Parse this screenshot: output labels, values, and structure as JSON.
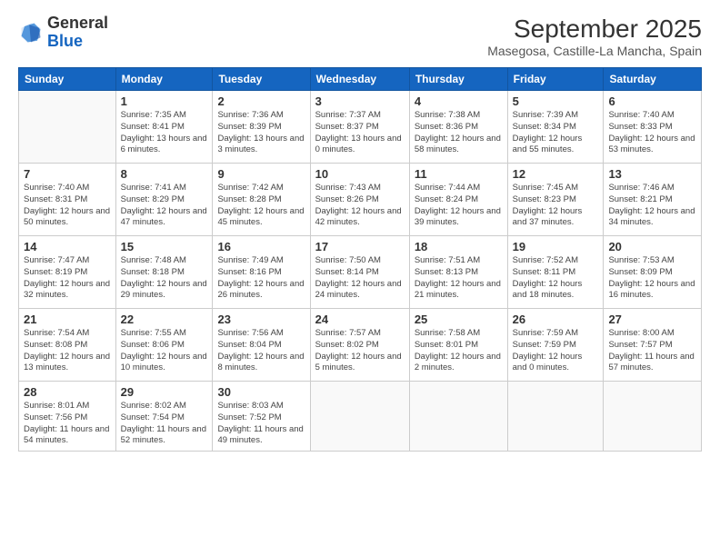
{
  "logo": {
    "general": "General",
    "blue": "Blue"
  },
  "header": {
    "month": "September 2025",
    "location": "Masegosa, Castille-La Mancha, Spain"
  },
  "weekdays": [
    "Sunday",
    "Monday",
    "Tuesday",
    "Wednesday",
    "Thursday",
    "Friday",
    "Saturday"
  ],
  "weeks": [
    [
      {
        "day": "",
        "sunrise": "",
        "sunset": "",
        "daylight": ""
      },
      {
        "day": "1",
        "sunrise": "Sunrise: 7:35 AM",
        "sunset": "Sunset: 8:41 PM",
        "daylight": "Daylight: 13 hours and 6 minutes."
      },
      {
        "day": "2",
        "sunrise": "Sunrise: 7:36 AM",
        "sunset": "Sunset: 8:39 PM",
        "daylight": "Daylight: 13 hours and 3 minutes."
      },
      {
        "day": "3",
        "sunrise": "Sunrise: 7:37 AM",
        "sunset": "Sunset: 8:37 PM",
        "daylight": "Daylight: 13 hours and 0 minutes."
      },
      {
        "day": "4",
        "sunrise": "Sunrise: 7:38 AM",
        "sunset": "Sunset: 8:36 PM",
        "daylight": "Daylight: 12 hours and 58 minutes."
      },
      {
        "day": "5",
        "sunrise": "Sunrise: 7:39 AM",
        "sunset": "Sunset: 8:34 PM",
        "daylight": "Daylight: 12 hours and 55 minutes."
      },
      {
        "day": "6",
        "sunrise": "Sunrise: 7:40 AM",
        "sunset": "Sunset: 8:33 PM",
        "daylight": "Daylight: 12 hours and 53 minutes."
      }
    ],
    [
      {
        "day": "7",
        "sunrise": "Sunrise: 7:40 AM",
        "sunset": "Sunset: 8:31 PM",
        "daylight": "Daylight: 12 hours and 50 minutes."
      },
      {
        "day": "8",
        "sunrise": "Sunrise: 7:41 AM",
        "sunset": "Sunset: 8:29 PM",
        "daylight": "Daylight: 12 hours and 47 minutes."
      },
      {
        "day": "9",
        "sunrise": "Sunrise: 7:42 AM",
        "sunset": "Sunset: 8:28 PM",
        "daylight": "Daylight: 12 hours and 45 minutes."
      },
      {
        "day": "10",
        "sunrise": "Sunrise: 7:43 AM",
        "sunset": "Sunset: 8:26 PM",
        "daylight": "Daylight: 12 hours and 42 minutes."
      },
      {
        "day": "11",
        "sunrise": "Sunrise: 7:44 AM",
        "sunset": "Sunset: 8:24 PM",
        "daylight": "Daylight: 12 hours and 39 minutes."
      },
      {
        "day": "12",
        "sunrise": "Sunrise: 7:45 AM",
        "sunset": "Sunset: 8:23 PM",
        "daylight": "Daylight: 12 hours and 37 minutes."
      },
      {
        "day": "13",
        "sunrise": "Sunrise: 7:46 AM",
        "sunset": "Sunset: 8:21 PM",
        "daylight": "Daylight: 12 hours and 34 minutes."
      }
    ],
    [
      {
        "day": "14",
        "sunrise": "Sunrise: 7:47 AM",
        "sunset": "Sunset: 8:19 PM",
        "daylight": "Daylight: 12 hours and 32 minutes."
      },
      {
        "day": "15",
        "sunrise": "Sunrise: 7:48 AM",
        "sunset": "Sunset: 8:18 PM",
        "daylight": "Daylight: 12 hours and 29 minutes."
      },
      {
        "day": "16",
        "sunrise": "Sunrise: 7:49 AM",
        "sunset": "Sunset: 8:16 PM",
        "daylight": "Daylight: 12 hours and 26 minutes."
      },
      {
        "day": "17",
        "sunrise": "Sunrise: 7:50 AM",
        "sunset": "Sunset: 8:14 PM",
        "daylight": "Daylight: 12 hours and 24 minutes."
      },
      {
        "day": "18",
        "sunrise": "Sunrise: 7:51 AM",
        "sunset": "Sunset: 8:13 PM",
        "daylight": "Daylight: 12 hours and 21 minutes."
      },
      {
        "day": "19",
        "sunrise": "Sunrise: 7:52 AM",
        "sunset": "Sunset: 8:11 PM",
        "daylight": "Daylight: 12 hours and 18 minutes."
      },
      {
        "day": "20",
        "sunrise": "Sunrise: 7:53 AM",
        "sunset": "Sunset: 8:09 PM",
        "daylight": "Daylight: 12 hours and 16 minutes."
      }
    ],
    [
      {
        "day": "21",
        "sunrise": "Sunrise: 7:54 AM",
        "sunset": "Sunset: 8:08 PM",
        "daylight": "Daylight: 12 hours and 13 minutes."
      },
      {
        "day": "22",
        "sunrise": "Sunrise: 7:55 AM",
        "sunset": "Sunset: 8:06 PM",
        "daylight": "Daylight: 12 hours and 10 minutes."
      },
      {
        "day": "23",
        "sunrise": "Sunrise: 7:56 AM",
        "sunset": "Sunset: 8:04 PM",
        "daylight": "Daylight: 12 hours and 8 minutes."
      },
      {
        "day": "24",
        "sunrise": "Sunrise: 7:57 AM",
        "sunset": "Sunset: 8:02 PM",
        "daylight": "Daylight: 12 hours and 5 minutes."
      },
      {
        "day": "25",
        "sunrise": "Sunrise: 7:58 AM",
        "sunset": "Sunset: 8:01 PM",
        "daylight": "Daylight: 12 hours and 2 minutes."
      },
      {
        "day": "26",
        "sunrise": "Sunrise: 7:59 AM",
        "sunset": "Sunset: 7:59 PM",
        "daylight": "Daylight: 12 hours and 0 minutes."
      },
      {
        "day": "27",
        "sunrise": "Sunrise: 8:00 AM",
        "sunset": "Sunset: 7:57 PM",
        "daylight": "Daylight: 11 hours and 57 minutes."
      }
    ],
    [
      {
        "day": "28",
        "sunrise": "Sunrise: 8:01 AM",
        "sunset": "Sunset: 7:56 PM",
        "daylight": "Daylight: 11 hours and 54 minutes."
      },
      {
        "day": "29",
        "sunrise": "Sunrise: 8:02 AM",
        "sunset": "Sunset: 7:54 PM",
        "daylight": "Daylight: 11 hours and 52 minutes."
      },
      {
        "day": "30",
        "sunrise": "Sunrise: 8:03 AM",
        "sunset": "Sunset: 7:52 PM",
        "daylight": "Daylight: 11 hours and 49 minutes."
      },
      {
        "day": "",
        "sunrise": "",
        "sunset": "",
        "daylight": ""
      },
      {
        "day": "",
        "sunrise": "",
        "sunset": "",
        "daylight": ""
      },
      {
        "day": "",
        "sunrise": "",
        "sunset": "",
        "daylight": ""
      },
      {
        "day": "",
        "sunrise": "",
        "sunset": "",
        "daylight": ""
      }
    ]
  ]
}
